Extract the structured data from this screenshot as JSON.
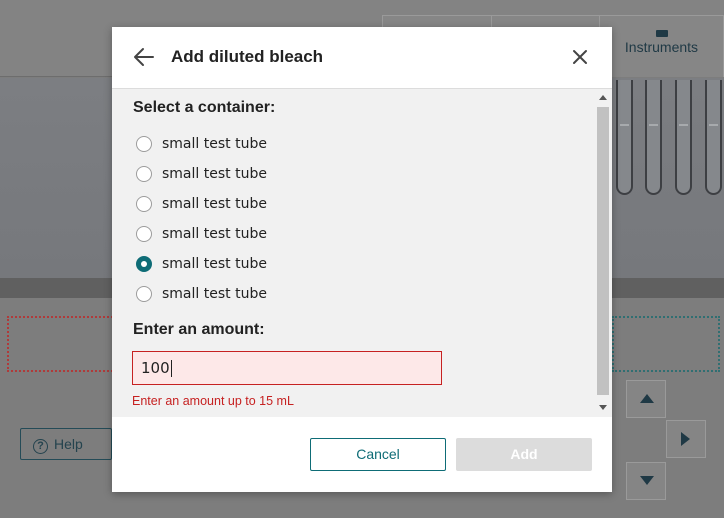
{
  "background": {
    "tabs": [
      "",
      "",
      "Instruments"
    ],
    "help_label": "Help"
  },
  "dialog": {
    "title": "Add diluted bleach",
    "container_heading": "Select a container:",
    "containers": [
      {
        "label": "small test tube",
        "selected": false
      },
      {
        "label": "small test tube",
        "selected": false
      },
      {
        "label": "small test tube",
        "selected": false
      },
      {
        "label": "small test tube",
        "selected": false
      },
      {
        "label": "small test tube",
        "selected": true
      },
      {
        "label": "small test tube",
        "selected": false
      }
    ],
    "amount_heading": "Enter an amount:",
    "amount_value": "100",
    "error_message": "Enter an amount up to 15 mL",
    "cancel_label": "Cancel",
    "add_label": "Add"
  },
  "colors": {
    "accent": "#0e6c76",
    "error": "#c62121",
    "error_bg": "#fde8e8",
    "disabled_button": "#dcdcdc"
  },
  "icons": {
    "back": "arrow-left-icon",
    "close": "close-icon",
    "help": "question-circle-icon",
    "instruments": "instruments-icon"
  }
}
